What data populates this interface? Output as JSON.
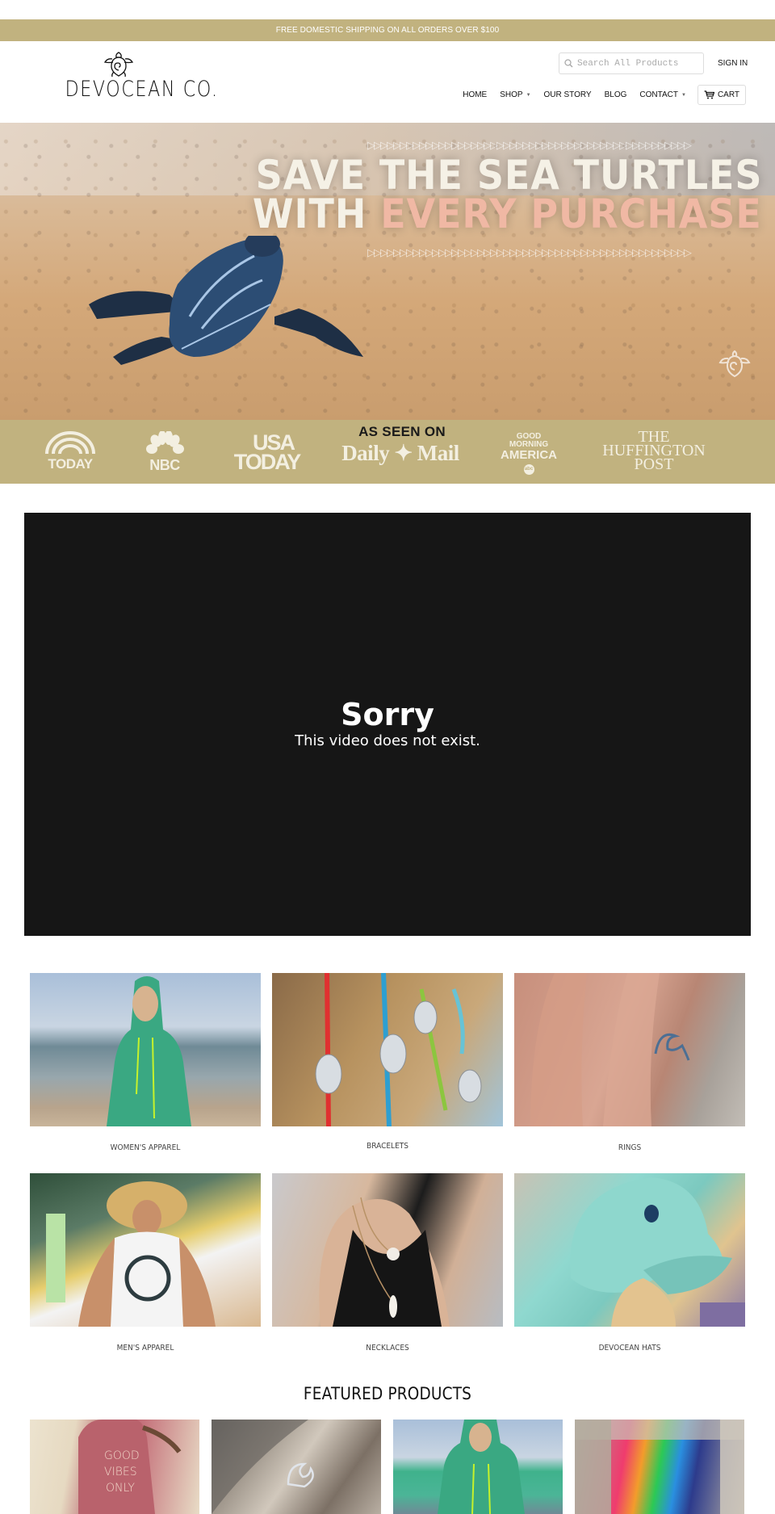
{
  "promo_bar": {
    "text": "FREE DOMESTIC SHIPPING ON ALL ORDERS OVER $100"
  },
  "brand": {
    "name": "DEVOCEAN CO.",
    "logo_icon": "turtle-icon"
  },
  "header": {
    "search_placeholder": "Search All Products",
    "sign_in": "SIGN IN",
    "nav": [
      {
        "label": "HOME",
        "has_dropdown": false
      },
      {
        "label": "SHOP",
        "has_dropdown": true
      },
      {
        "label": "OUR STORY",
        "has_dropdown": false
      },
      {
        "label": "BLOG",
        "has_dropdown": false
      },
      {
        "label": "CONTACT",
        "has_dropdown": true
      }
    ],
    "cart_label": "CART",
    "dropdown_glyph": "▼"
  },
  "hero": {
    "deco": "▷▷▷▷▷▷▷▷▷▷▷▷▷▷▷▷▷▷▷▷▷▷▷▷▷▷▷▷▷▷▷▷▷▷▷▷▷▷▷▷▷▷▷▷▷▷▷▷▷▷",
    "line1": "SAVE THE SEA TURTLES",
    "line2_plain": "WITH ",
    "line2_accent": "EVERY PURCHASE",
    "accent_color": "#f0b8a4"
  },
  "press": {
    "title": "AS SEEN ON",
    "logos": {
      "today": "TODAY",
      "nbc": "NBC",
      "usa_line1": "USA",
      "usa_line2": "TODAY",
      "daily_mail": "Daily ✦ Mail",
      "gma_line1": "GOOD",
      "gma_line2": "MORNING",
      "gma_line3": "AMERICA",
      "gma_badge": "abc",
      "huff_line1": "THE",
      "huff_line2": "HUFFINGTON",
      "huff_line3": "POST"
    }
  },
  "video": {
    "title": "Sorry",
    "message": "This video does not exist."
  },
  "categories": [
    {
      "label": "WOMEN'S APPAREL"
    },
    {
      "label": "BRACELETS"
    },
    {
      "label": "RINGS"
    },
    {
      "label": "MEN'S APPAREL"
    },
    {
      "label": "NECKLACES"
    },
    {
      "label": "DEVOCEAN HATS"
    }
  ],
  "featured": {
    "title": "FEATURED PRODUCTS",
    "products": [
      {
        "image_alt": "Good Vibes Only tank top",
        "overlay_text": "GOOD VIBES ONLY"
      },
      {
        "image_alt": "Wave ring on driftwood"
      },
      {
        "image_alt": "Green hoodie on beach"
      },
      {
        "image_alt": "Rainbow bead bracelets"
      }
    ]
  },
  "colors": {
    "brand_gold": "#c1b27f",
    "video_bg": "#161616",
    "hero_text": "#f5f1e6"
  }
}
